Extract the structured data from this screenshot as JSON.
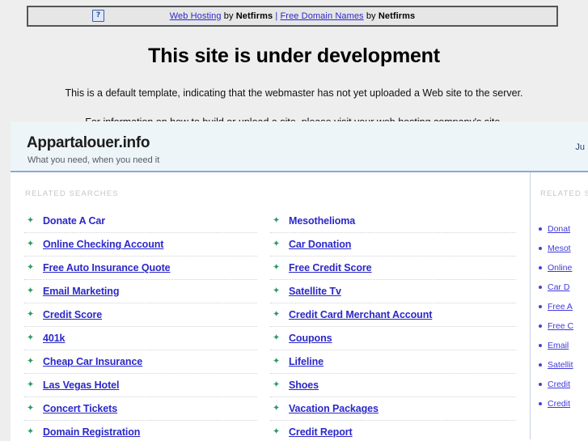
{
  "banner": {
    "icon": "broken-image-icon",
    "icon_glyph": "?",
    "link1": "Web Hosting",
    "by1": " by ",
    "brand1": "Netfirms",
    "separator": " | ",
    "link2": "Free Domain Names",
    "by2": " by ",
    "brand2": "Netfirms"
  },
  "page": {
    "title": "This site is under development",
    "para1": "This is a default template, indicating that the webmaster has not yet uploaded a Web site to the server.",
    "para2": "For information on how to build or upload a site, please visit your web hosting company's site."
  },
  "parked": {
    "title": "Appartalouer.info",
    "tagline": "What you need, when you need it",
    "header_link": "Ju",
    "section_label": "RELATED SEARCHES",
    "sidebar_label": "RELATED SE.",
    "column_left": [
      "Donate A Car",
      "Online Checking Account",
      "Free Auto Insurance Quote",
      "Email Marketing",
      "Credit Score",
      "401k",
      "Cheap Car Insurance",
      "Las Vegas Hotel",
      "Concert Tickets",
      "Domain Registration"
    ],
    "column_right": [
      "Mesothelioma",
      "Car Donation",
      "Free Credit Score",
      "Satellite Tv",
      "Credit Card Merchant Account",
      "Coupons",
      "Lifeline",
      "Shoes",
      "Vacation Packages",
      "Credit Report"
    ],
    "sidebar_links": [
      "Donat",
      "Mesot",
      "Online",
      "Car D",
      "Free A",
      "Free C",
      "Email",
      "Satellit",
      "Credit",
      "Credit"
    ]
  },
  "colors": {
    "link_blue": "#2b28c8",
    "arrow_green": "#2e9b63",
    "panel_header_bg": "#eef5f8",
    "panel_header_border": "#8fa8d8",
    "page_bg": "#eeeeee"
  }
}
